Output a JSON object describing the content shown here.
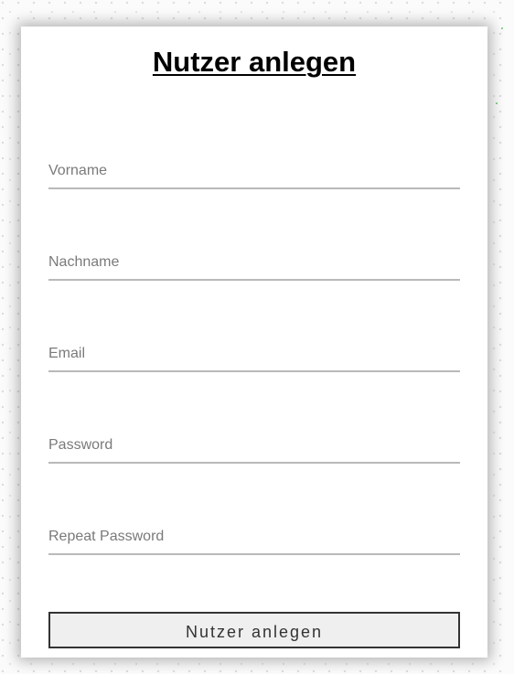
{
  "form": {
    "title": "Nutzer anlegen",
    "fields": [
      {
        "name": "vorname",
        "placeholder": "Vorname",
        "value": ""
      },
      {
        "name": "nachname",
        "placeholder": "Nachname",
        "value": ""
      },
      {
        "name": "email",
        "placeholder": "Email",
        "value": ""
      },
      {
        "name": "password",
        "placeholder": "Password",
        "value": ""
      },
      {
        "name": "repeat_password",
        "placeholder": "Repeat Password",
        "value": ""
      }
    ],
    "submit_label": "Nutzer anlegen"
  },
  "colors": {
    "card_background": "#ffffff",
    "page_background": "#fbfbfb",
    "input_underline": "#b9b9b9",
    "placeholder_text": "#7a7a7a",
    "button_background": "#efefef",
    "button_border": "#333333",
    "title_text": "#000000"
  }
}
